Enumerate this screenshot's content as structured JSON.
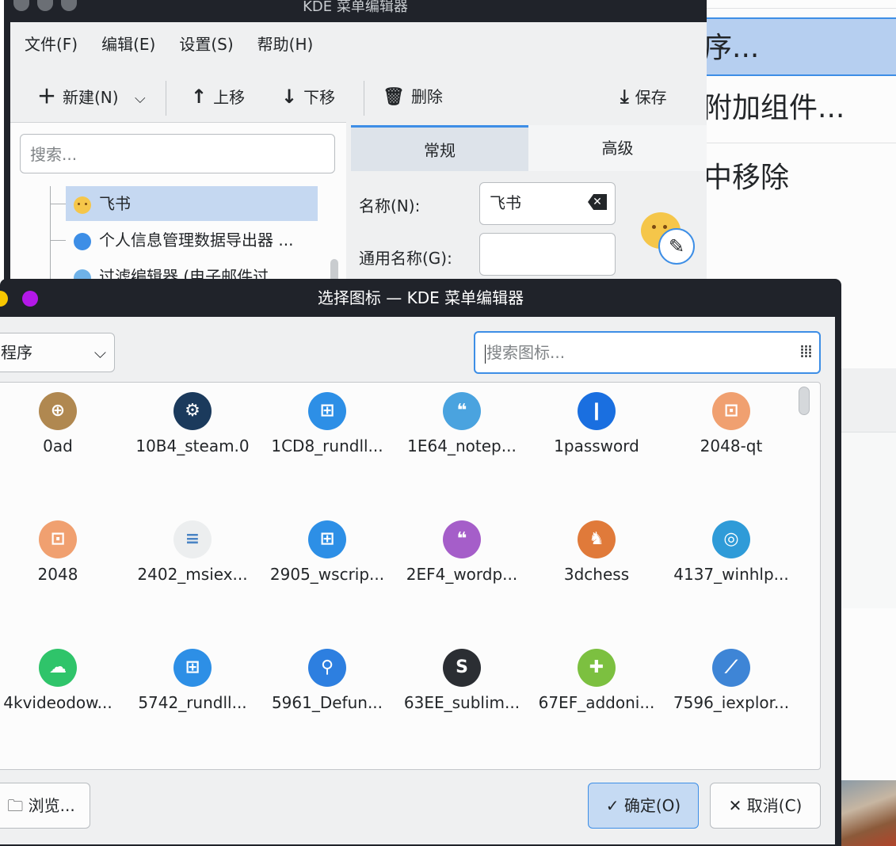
{
  "main_window": {
    "title": "KDE 菜单编辑器",
    "menu": [
      "文件(F)",
      "编辑(E)",
      "设置(S)",
      "帮助(H)"
    ],
    "toolbar": {
      "new_label": "新建(N)",
      "move_up_label": "上移",
      "move_down_label": "下移",
      "delete_label": "删除",
      "save_label": "保存"
    },
    "search_placeholder": "搜索...",
    "tree_items": [
      "飞书",
      "个人信息管理数据导出器 ...",
      "过滤编辑器 (电子邮件过..."
    ],
    "tabs": [
      "常规",
      "高级"
    ],
    "name_label": "名称(N):",
    "name_value": "飞书",
    "generic_name_label": "通用名称(G):",
    "generic_name_value": ""
  },
  "background_app": {
    "items": [
      "序...",
      "附加组件...",
      "中移除"
    ]
  },
  "dialog": {
    "title": "选择图标 — KDE 菜单编辑器",
    "category_value": "程序",
    "search_placeholder": "搜索图标...",
    "icons": [
      {
        "label": "0ad",
        "icon": "0ad-icon",
        "color": "#b08850"
      },
      {
        "label": "10B4_steam.0",
        "icon": "steam-icon",
        "color": "#1b3a5c"
      },
      {
        "label": "1CD8_rundll...",
        "icon": "windows-icon",
        "color": "#2d8fe6"
      },
      {
        "label": "1E64_notep...",
        "icon": "notepad-icon",
        "color": "#4aa3df"
      },
      {
        "label": "1password",
        "icon": "1password-icon",
        "color": "#1a6fe0"
      },
      {
        "label": "2048-qt",
        "icon": "2048-qt-icon",
        "color": "#f0a070"
      },
      {
        "label": "2048",
        "icon": "2048-icon",
        "color": "#f0a070"
      },
      {
        "label": "2402_msiex...",
        "icon": "msiexec-icon",
        "color": "#eceeef"
      },
      {
        "label": "2905_wscrip...",
        "icon": "windows-icon",
        "color": "#2d8fe6"
      },
      {
        "label": "2EF4_wordp...",
        "icon": "wordpad-icon",
        "color": "#a55ec9"
      },
      {
        "label": "3dchess",
        "icon": "chess-knight-icon",
        "color": "#e07a3a"
      },
      {
        "label": "4137_winhlp...",
        "icon": "lifebuoy-icon",
        "color": "#2f9bd8"
      },
      {
        "label": "4kvideodow...",
        "icon": "cloud-icon",
        "color": "#2fc46a"
      },
      {
        "label": "5742_rundll...",
        "icon": "windows-icon",
        "color": "#2d8fe6"
      },
      {
        "label": "5961_Defun...",
        "icon": "search-icon",
        "color": "#2d7fe0"
      },
      {
        "label": "63EE_sublim...",
        "icon": "sublime-icon",
        "color": "#2b2e33"
      },
      {
        "label": "67EF_addoni...",
        "icon": "puzzle-icon",
        "color": "#7cc040"
      },
      {
        "label": "7596_iexplor...",
        "icon": "compass-icon",
        "color": "#3e85d6"
      }
    ],
    "browse_label": "浏览...",
    "ok_label": "确定(O)",
    "cancel_label": "取消(C)"
  }
}
